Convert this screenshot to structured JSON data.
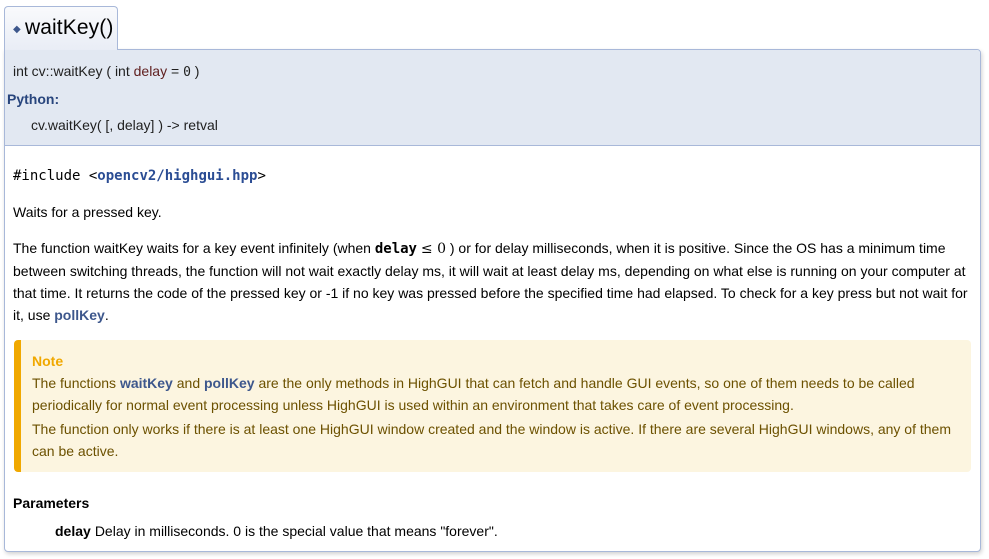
{
  "member": {
    "title": "waitKey()",
    "icon": "diamond-icon"
  },
  "prototype": {
    "return_type": "int cv::waitKey",
    "open_paren": "(",
    "param_type": "int",
    "param_name": "delay",
    "equals": "=",
    "default_value": "0",
    "close_paren": ")",
    "python_label": "Python:",
    "python_signature": "cv.waitKey( [, delay] ) -> retval"
  },
  "include": {
    "prefix": "#include <",
    "header": "opencv2/highgui.hpp",
    "suffix": ">"
  },
  "brief": "Waits for a pressed key.",
  "description": {
    "part1": "The function waitKey waits for a key event infinitely (when ",
    "code": "delay",
    "math": "≤ 0",
    "part2": ") or for delay milliseconds, when it is positive. Since the OS has a minimum time between switching threads, the function will not wait exactly delay ms, it will wait at least delay ms, depending on what else is running on your computer at that time. It returns the code of the pressed key or -1 if no key was pressed before the specified time had elapsed. To check for a key press but not wait for it, use ",
    "link": "pollKey",
    "part3": "."
  },
  "note": {
    "title": "Note",
    "p1_a": "The functions ",
    "p1_link1": "waitKey",
    "p1_b": " and ",
    "p1_link2": "pollKey",
    "p1_c": " are the only methods in HighGUI that can fetch and handle GUI events, so one of them needs to be called periodically for normal event processing unless HighGUI is used within an environment that takes care of event processing.",
    "p2": "The function only works if there is at least one HighGUI window created and the window is active. If there are several HighGUI windows, any of them can be active."
  },
  "parameters": {
    "heading": "Parameters",
    "items": [
      {
        "name": "delay",
        "description": "Delay in milliseconds. 0 is the special value that means \"forever\"."
      }
    ]
  }
}
